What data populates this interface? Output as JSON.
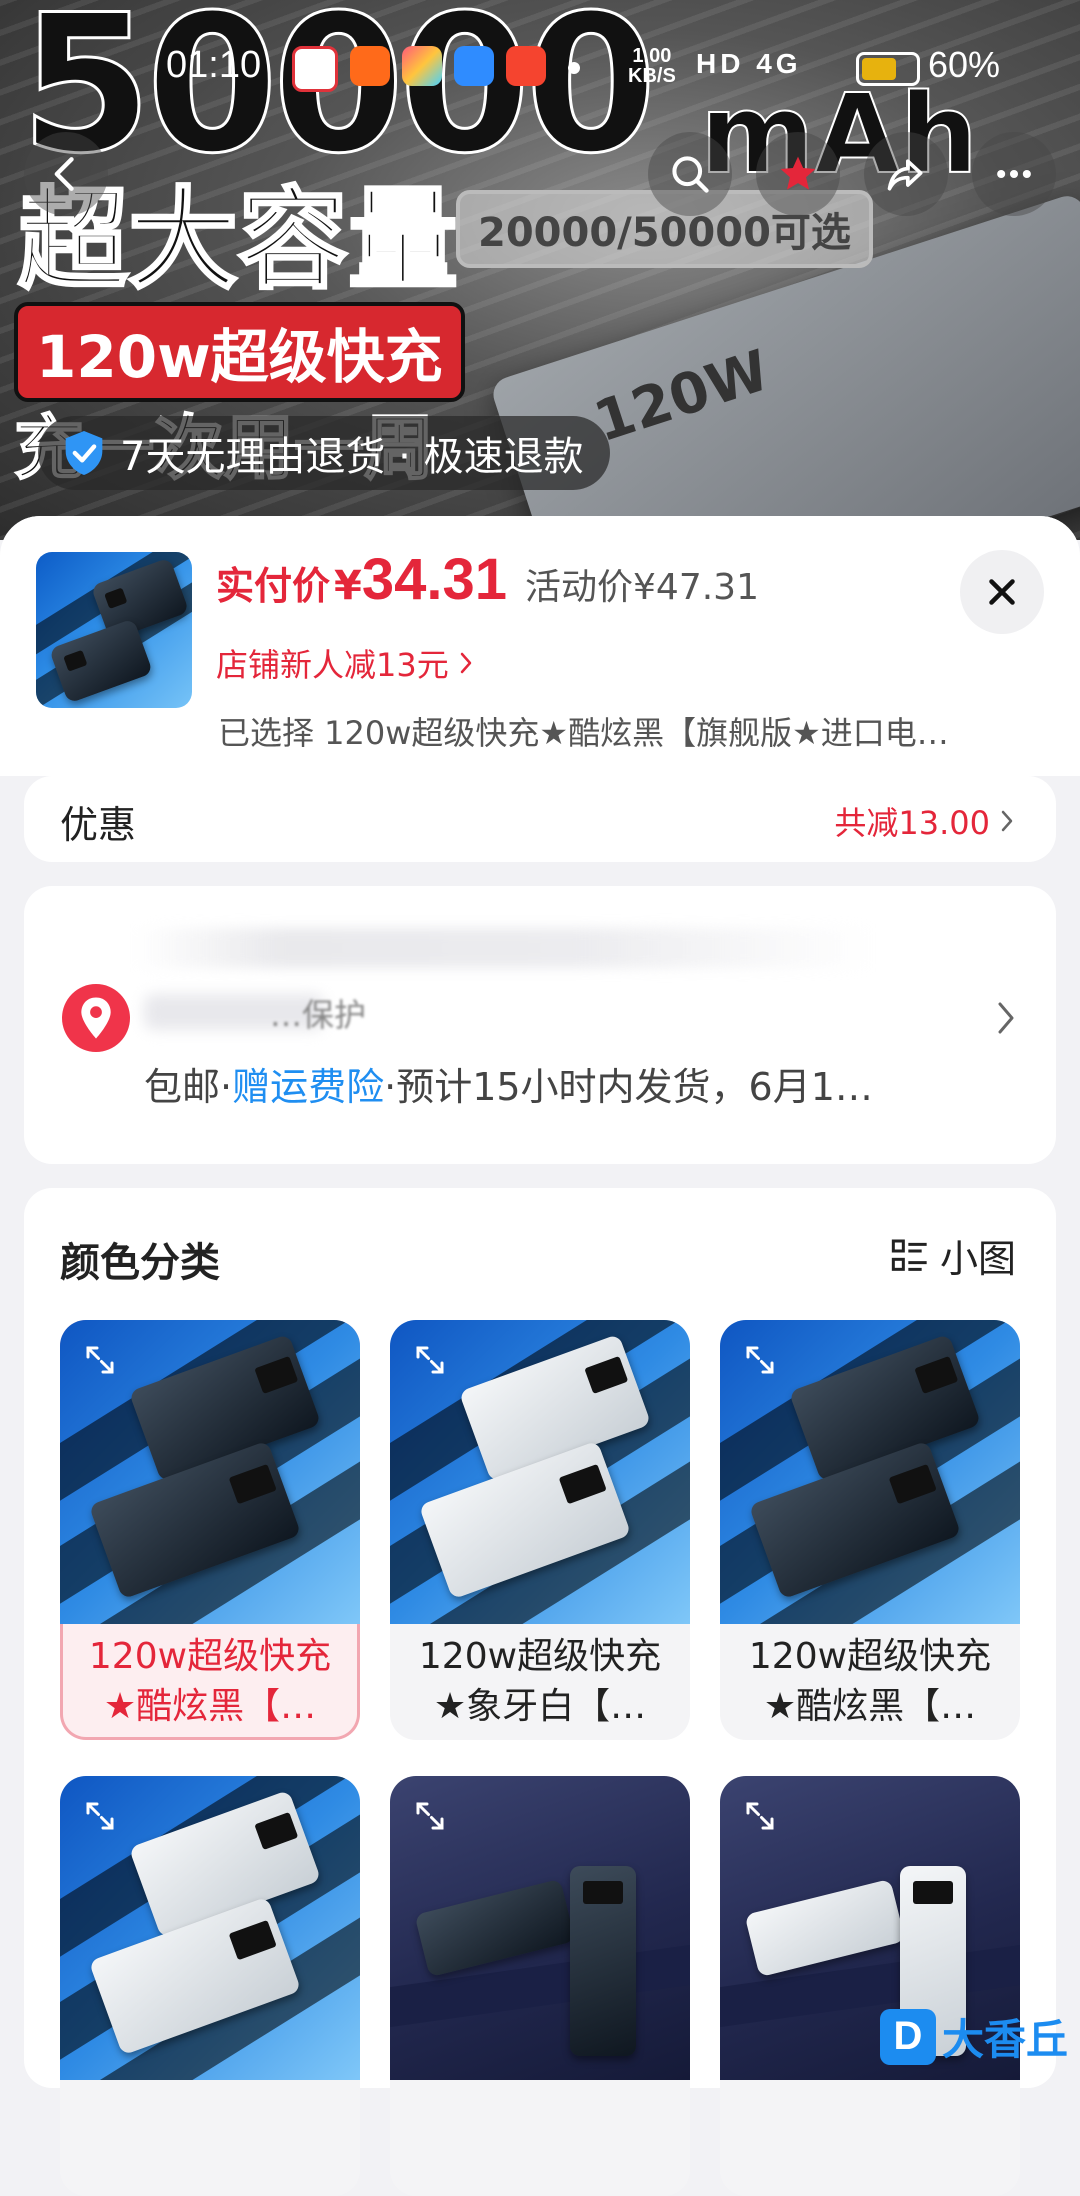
{
  "status_bar": {
    "time": "01:10",
    "net_speed_value": "1.00",
    "net_speed_unit": "KB/S",
    "network": "HD 4G",
    "battery_pct": "60%"
  },
  "hero": {
    "headline": "50000",
    "unit": "mAh",
    "capacity_text": "超大容量",
    "capacity_options": "20000/50000可选",
    "fast_charge": "120w超级快充",
    "slogan": "充一次用一周",
    "device_label": "120W",
    "return_policy": "7天无理由退货 · 极速退款"
  },
  "product": {
    "price_label": "实付价",
    "currency": "¥",
    "price": "34.31",
    "activity_price": "活动价¥47.31",
    "promo": "店铺新人减13元",
    "selected": "已选择 120w超级快充★酷炫黑【旗舰版★进口电…"
  },
  "discount": {
    "title": "优惠",
    "value": "共减13.00"
  },
  "address": {
    "partial_text": "…保护",
    "shipping_free": "包邮",
    "insurance": "赠运费险",
    "estimate": "·预计15小时内发货，6月1…"
  },
  "colors": {
    "title": "颜色分类",
    "view_mode": "小图",
    "options": [
      {
        "line1": "120w超级快充",
        "line2": "★酷炫黑【…"
      },
      {
        "line1": "120w超级快充",
        "line2": "★象牙白【…"
      },
      {
        "line1": "120w超级快充",
        "line2": "★酷炫黑【…"
      },
      {
        "line1": "",
        "line2": ""
      },
      {
        "line1": "",
        "line2": ""
      },
      {
        "line1": "",
        "line2": ""
      }
    ]
  },
  "watermark": {
    "logo": "D",
    "text": "大香丘"
  },
  "theme": {
    "accent": "#e4263a",
    "link": "#1f8ef1",
    "location_pin": "#f0344a"
  }
}
